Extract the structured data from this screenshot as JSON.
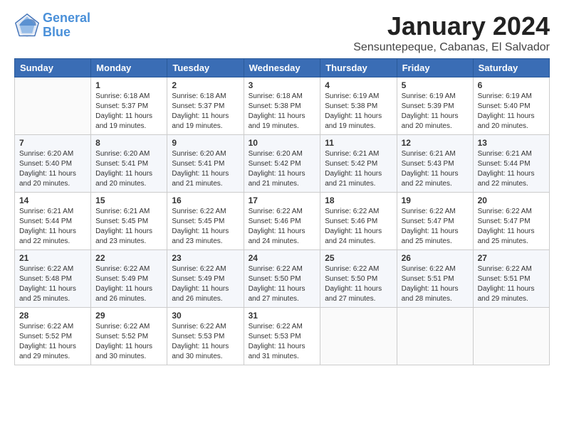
{
  "header": {
    "logo_line1": "General",
    "logo_line2": "Blue",
    "month_year": "January 2024",
    "subtitle": "Sensuntepeque, Cabanas, El Salvador"
  },
  "weekdays": [
    "Sunday",
    "Monday",
    "Tuesday",
    "Wednesday",
    "Thursday",
    "Friday",
    "Saturday"
  ],
  "weeks": [
    [
      {
        "day": "",
        "sunrise": "",
        "sunset": "",
        "daylight": ""
      },
      {
        "day": "1",
        "sunrise": "Sunrise: 6:18 AM",
        "sunset": "Sunset: 5:37 PM",
        "daylight": "Daylight: 11 hours and 19 minutes."
      },
      {
        "day": "2",
        "sunrise": "Sunrise: 6:18 AM",
        "sunset": "Sunset: 5:37 PM",
        "daylight": "Daylight: 11 hours and 19 minutes."
      },
      {
        "day": "3",
        "sunrise": "Sunrise: 6:18 AM",
        "sunset": "Sunset: 5:38 PM",
        "daylight": "Daylight: 11 hours and 19 minutes."
      },
      {
        "day": "4",
        "sunrise": "Sunrise: 6:19 AM",
        "sunset": "Sunset: 5:38 PM",
        "daylight": "Daylight: 11 hours and 19 minutes."
      },
      {
        "day": "5",
        "sunrise": "Sunrise: 6:19 AM",
        "sunset": "Sunset: 5:39 PM",
        "daylight": "Daylight: 11 hours and 20 minutes."
      },
      {
        "day": "6",
        "sunrise": "Sunrise: 6:19 AM",
        "sunset": "Sunset: 5:40 PM",
        "daylight": "Daylight: 11 hours and 20 minutes."
      }
    ],
    [
      {
        "day": "7",
        "sunrise": "Sunrise: 6:20 AM",
        "sunset": "Sunset: 5:40 PM",
        "daylight": "Daylight: 11 hours and 20 minutes."
      },
      {
        "day": "8",
        "sunrise": "Sunrise: 6:20 AM",
        "sunset": "Sunset: 5:41 PM",
        "daylight": "Daylight: 11 hours and 20 minutes."
      },
      {
        "day": "9",
        "sunrise": "Sunrise: 6:20 AM",
        "sunset": "Sunset: 5:41 PM",
        "daylight": "Daylight: 11 hours and 21 minutes."
      },
      {
        "day": "10",
        "sunrise": "Sunrise: 6:20 AM",
        "sunset": "Sunset: 5:42 PM",
        "daylight": "Daylight: 11 hours and 21 minutes."
      },
      {
        "day": "11",
        "sunrise": "Sunrise: 6:21 AM",
        "sunset": "Sunset: 5:42 PM",
        "daylight": "Daylight: 11 hours and 21 minutes."
      },
      {
        "day": "12",
        "sunrise": "Sunrise: 6:21 AM",
        "sunset": "Sunset: 5:43 PM",
        "daylight": "Daylight: 11 hours and 22 minutes."
      },
      {
        "day": "13",
        "sunrise": "Sunrise: 6:21 AM",
        "sunset": "Sunset: 5:44 PM",
        "daylight": "Daylight: 11 hours and 22 minutes."
      }
    ],
    [
      {
        "day": "14",
        "sunrise": "Sunrise: 6:21 AM",
        "sunset": "Sunset: 5:44 PM",
        "daylight": "Daylight: 11 hours and 22 minutes."
      },
      {
        "day": "15",
        "sunrise": "Sunrise: 6:21 AM",
        "sunset": "Sunset: 5:45 PM",
        "daylight": "Daylight: 11 hours and 23 minutes."
      },
      {
        "day": "16",
        "sunrise": "Sunrise: 6:22 AM",
        "sunset": "Sunset: 5:45 PM",
        "daylight": "Daylight: 11 hours and 23 minutes."
      },
      {
        "day": "17",
        "sunrise": "Sunrise: 6:22 AM",
        "sunset": "Sunset: 5:46 PM",
        "daylight": "Daylight: 11 hours and 24 minutes."
      },
      {
        "day": "18",
        "sunrise": "Sunrise: 6:22 AM",
        "sunset": "Sunset: 5:46 PM",
        "daylight": "Daylight: 11 hours and 24 minutes."
      },
      {
        "day": "19",
        "sunrise": "Sunrise: 6:22 AM",
        "sunset": "Sunset: 5:47 PM",
        "daylight": "Daylight: 11 hours and 25 minutes."
      },
      {
        "day": "20",
        "sunrise": "Sunrise: 6:22 AM",
        "sunset": "Sunset: 5:47 PM",
        "daylight": "Daylight: 11 hours and 25 minutes."
      }
    ],
    [
      {
        "day": "21",
        "sunrise": "Sunrise: 6:22 AM",
        "sunset": "Sunset: 5:48 PM",
        "daylight": "Daylight: 11 hours and 25 minutes."
      },
      {
        "day": "22",
        "sunrise": "Sunrise: 6:22 AM",
        "sunset": "Sunset: 5:49 PM",
        "daylight": "Daylight: 11 hours and 26 minutes."
      },
      {
        "day": "23",
        "sunrise": "Sunrise: 6:22 AM",
        "sunset": "Sunset: 5:49 PM",
        "daylight": "Daylight: 11 hours and 26 minutes."
      },
      {
        "day": "24",
        "sunrise": "Sunrise: 6:22 AM",
        "sunset": "Sunset: 5:50 PM",
        "daylight": "Daylight: 11 hours and 27 minutes."
      },
      {
        "day": "25",
        "sunrise": "Sunrise: 6:22 AM",
        "sunset": "Sunset: 5:50 PM",
        "daylight": "Daylight: 11 hours and 27 minutes."
      },
      {
        "day": "26",
        "sunrise": "Sunrise: 6:22 AM",
        "sunset": "Sunset: 5:51 PM",
        "daylight": "Daylight: 11 hours and 28 minutes."
      },
      {
        "day": "27",
        "sunrise": "Sunrise: 6:22 AM",
        "sunset": "Sunset: 5:51 PM",
        "daylight": "Daylight: 11 hours and 29 minutes."
      }
    ],
    [
      {
        "day": "28",
        "sunrise": "Sunrise: 6:22 AM",
        "sunset": "Sunset: 5:52 PM",
        "daylight": "Daylight: 11 hours and 29 minutes."
      },
      {
        "day": "29",
        "sunrise": "Sunrise: 6:22 AM",
        "sunset": "Sunset: 5:52 PM",
        "daylight": "Daylight: 11 hours and 30 minutes."
      },
      {
        "day": "30",
        "sunrise": "Sunrise: 6:22 AM",
        "sunset": "Sunset: 5:53 PM",
        "daylight": "Daylight: 11 hours and 30 minutes."
      },
      {
        "day": "31",
        "sunrise": "Sunrise: 6:22 AM",
        "sunset": "Sunset: 5:53 PM",
        "daylight": "Daylight: 11 hours and 31 minutes."
      },
      {
        "day": "",
        "sunrise": "",
        "sunset": "",
        "daylight": ""
      },
      {
        "day": "",
        "sunrise": "",
        "sunset": "",
        "daylight": ""
      },
      {
        "day": "",
        "sunrise": "",
        "sunset": "",
        "daylight": ""
      }
    ]
  ]
}
